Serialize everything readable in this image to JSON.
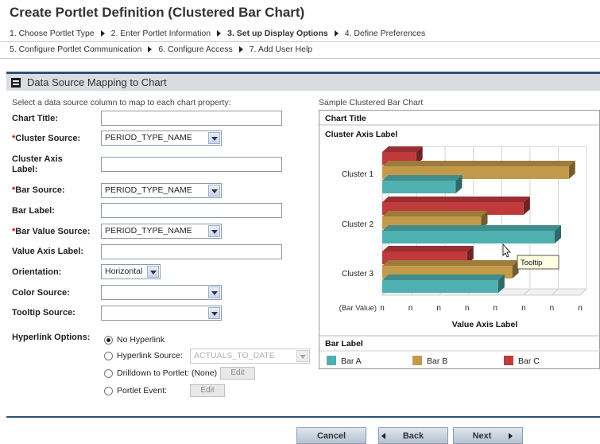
{
  "page_title": "Create Portlet Definition (Clustered Bar Chart)",
  "steps_row1": [
    {
      "label": "1. Choose Portlet Type",
      "active": false
    },
    {
      "label": "2. Enter Portlet Information",
      "active": false
    },
    {
      "label": "3. Set up Display Options",
      "active": true
    },
    {
      "label": "4. Define Preferences",
      "active": false
    }
  ],
  "steps_row2": [
    {
      "label": "5. Configure Portlet Communication",
      "active": false
    },
    {
      "label": "6. Configure Access",
      "active": false
    },
    {
      "label": "7. Add User Help",
      "active": false
    }
  ],
  "section_title": "Data Source Mapping to Chart",
  "instructions": "Select a data source column to map to each chart property:",
  "sample_label": "Sample Clustered Bar Chart",
  "form": {
    "chart_title": {
      "label": "Chart Title:",
      "value": ""
    },
    "cluster_source": {
      "label": "Cluster Source:",
      "required_mark": "*",
      "value": "PERIOD_TYPE_NAME"
    },
    "cluster_axis_label": {
      "label_line1": "Cluster Axis",
      "label_line2": "Label:",
      "value": ""
    },
    "bar_source": {
      "label": "Bar Source:",
      "required_mark": "*",
      "value": "PERIOD_TYPE_NAME"
    },
    "bar_label": {
      "label": "Bar Label:",
      "value": ""
    },
    "bar_value_source": {
      "label": "Bar Value Source:",
      "required_mark": "*",
      "value": "PERIOD_TYPE_NAME"
    },
    "value_axis_label": {
      "label": "Value Axis Label:",
      "value": ""
    },
    "orientation": {
      "label": "Orientation:",
      "value": "Horizontal"
    },
    "color_source": {
      "label": "Color Source:",
      "value": ""
    },
    "tooltip_source": {
      "label": "Tooltip Source:",
      "value": ""
    },
    "hyperlink": {
      "label": "Hyperlink Options:",
      "no_hyperlink": "No Hyperlink",
      "hyperlink_source": "Hyperlink Source:",
      "hyperlink_source_value": "ACTUALS_TO_DATE",
      "drilldown": "Drilldown to Portlet:",
      "drilldown_value": "(None)",
      "portlet_event": "Portlet Event:",
      "edit_label": "Edit",
      "selected": "no_hyperlink"
    }
  },
  "chart_data": {
    "type": "bar",
    "orientation": "horizontal",
    "title": "Chart Title",
    "cluster_axis_label": "Cluster Axis Label",
    "categories": [
      "Cluster 1",
      "Cluster 2",
      "Cluster 3"
    ],
    "series": [
      {
        "name": "Bar C",
        "color": "#c0393c",
        "values": [
          1.2,
          5.0,
          3.0
        ]
      },
      {
        "name": "Bar B",
        "color": "#c39a4a",
        "values": [
          6.6,
          3.5,
          4.6
        ]
      },
      {
        "name": "Bar A",
        "color": "#4fb0b0",
        "values": [
          2.6,
          6.1,
          4.1
        ]
      }
    ],
    "x_tick_prefix": "(Bar Value)",
    "x_ticks": [
      "n",
      "n",
      "n",
      "n",
      "n",
      "n",
      "n",
      "n"
    ],
    "xlim": [
      0,
      7
    ],
    "xlabel": "Value Axis Label",
    "legend_title": "Bar Label",
    "legend": [
      {
        "name": "Bar A",
        "color": "#4fb0b0"
      },
      {
        "name": "Bar B",
        "color": "#c39a4a"
      },
      {
        "name": "Bar C",
        "color": "#c0393c"
      }
    ],
    "tooltip": "Tooltip",
    "grid": true,
    "legend_position": "bottom"
  },
  "buttons": {
    "cancel": "Cancel",
    "back": "Back",
    "next": "Next"
  }
}
